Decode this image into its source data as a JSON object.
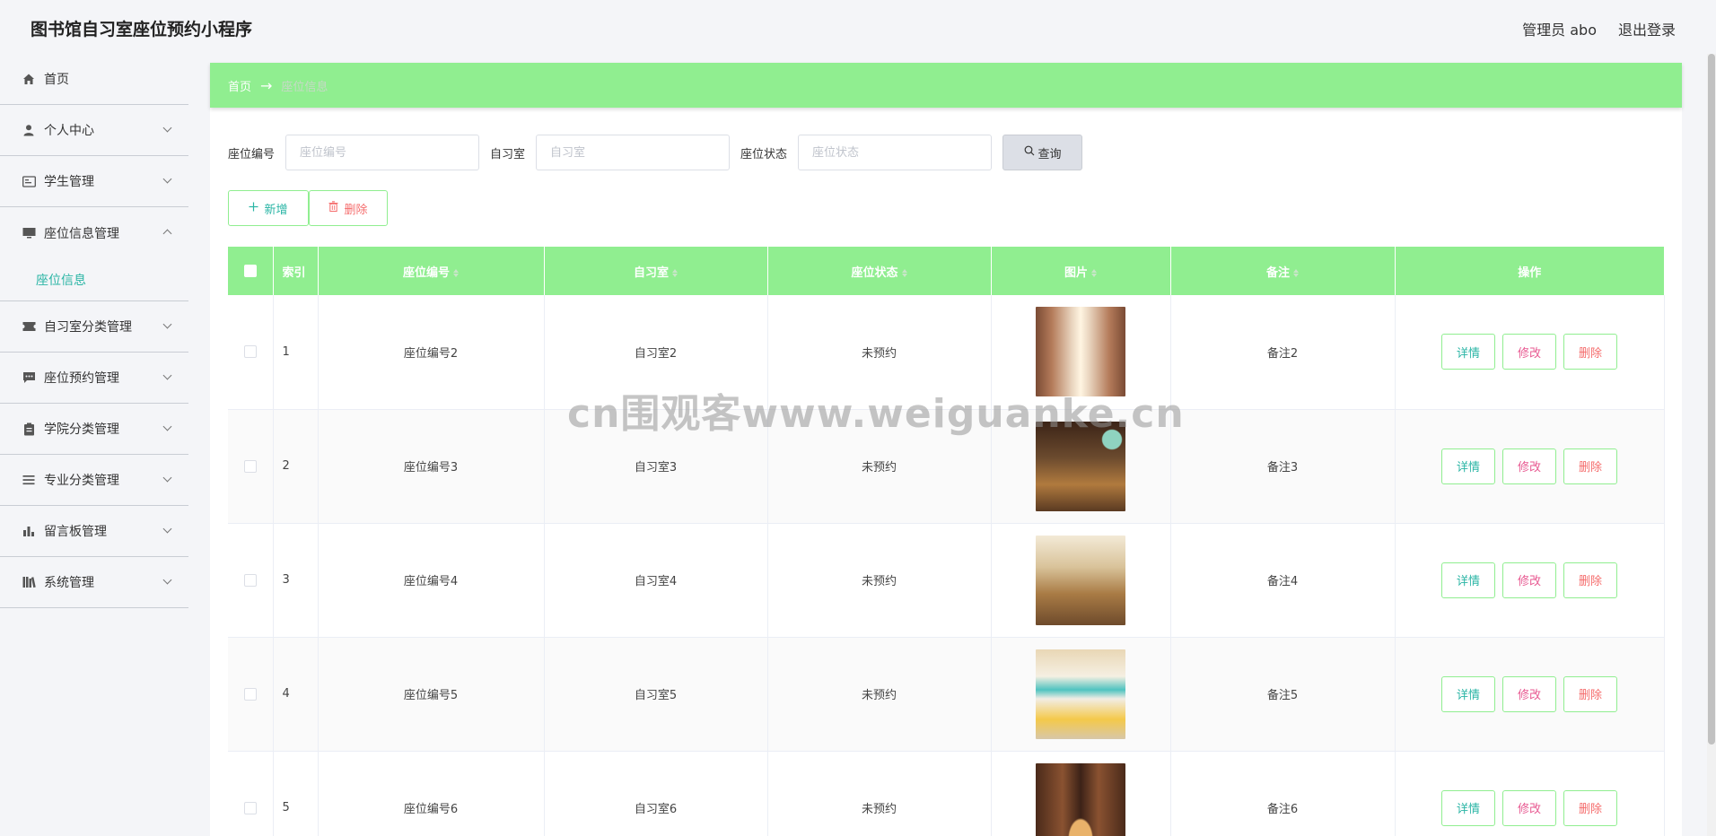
{
  "app": {
    "title": "图书馆自习室座位预约小程序"
  },
  "user": {
    "role_label": "管理员 abo",
    "logout": "退出登录"
  },
  "sidebar": {
    "items": [
      {
        "label": "首页",
        "icon": "home-icon"
      },
      {
        "label": "个人中心",
        "icon": "user-icon"
      },
      {
        "label": "学生管理",
        "icon": "id-card-icon"
      },
      {
        "label": "座位信息管理",
        "icon": "monitor-icon"
      },
      {
        "label": "自习室分类管理",
        "icon": "ticket-icon"
      },
      {
        "label": "座位预约管理",
        "icon": "chat-icon"
      },
      {
        "label": "学院分类管理",
        "icon": "clipboard-icon"
      },
      {
        "label": "专业分类管理",
        "icon": "list-icon"
      },
      {
        "label": "留言板管理",
        "icon": "bar-chart-icon"
      },
      {
        "label": "系统管理",
        "icon": "library-icon"
      }
    ],
    "submenu_active": "座位信息"
  },
  "breadcrumb": {
    "home": "首页",
    "arrow": "→",
    "current": "座位信息"
  },
  "search": {
    "seat_no_label": "座位编号",
    "seat_no_placeholder": "座位编号",
    "room_label": "自习室",
    "room_placeholder": "自习室",
    "status_label": "座位状态",
    "status_placeholder": "座位状态",
    "query_label": "查询"
  },
  "actions": {
    "add": "新增",
    "delete": "删除"
  },
  "table": {
    "headers": {
      "index": "索引",
      "seat_no": "座位编号",
      "room": "自习室",
      "status": "座位状态",
      "image": "图片",
      "note": "备注",
      "ops": "操作"
    },
    "op_labels": {
      "detail": "详情",
      "edit": "修改",
      "remove": "删除"
    },
    "rows": [
      {
        "index": "1",
        "seat_no": "座位编号2",
        "room": "自习室2",
        "status": "未预约",
        "note": "备注2"
      },
      {
        "index": "2",
        "seat_no": "座位编号3",
        "room": "自习室3",
        "status": "未预约",
        "note": "备注3"
      },
      {
        "index": "3",
        "seat_no": "座位编号4",
        "room": "自习室4",
        "status": "未预约",
        "note": "备注4"
      },
      {
        "index": "4",
        "seat_no": "座位编号5",
        "room": "自习室5",
        "status": "未预约",
        "note": "备注5"
      },
      {
        "index": "5",
        "seat_no": "座位编号6",
        "room": "自习室6",
        "status": "未预约",
        "note": "备注6"
      }
    ]
  },
  "watermark": "cn围观客www.weiguanke.cn",
  "colors": {
    "accent": "#90ee90",
    "teal": "#2ab5a5",
    "danger": "#f56c6c"
  }
}
